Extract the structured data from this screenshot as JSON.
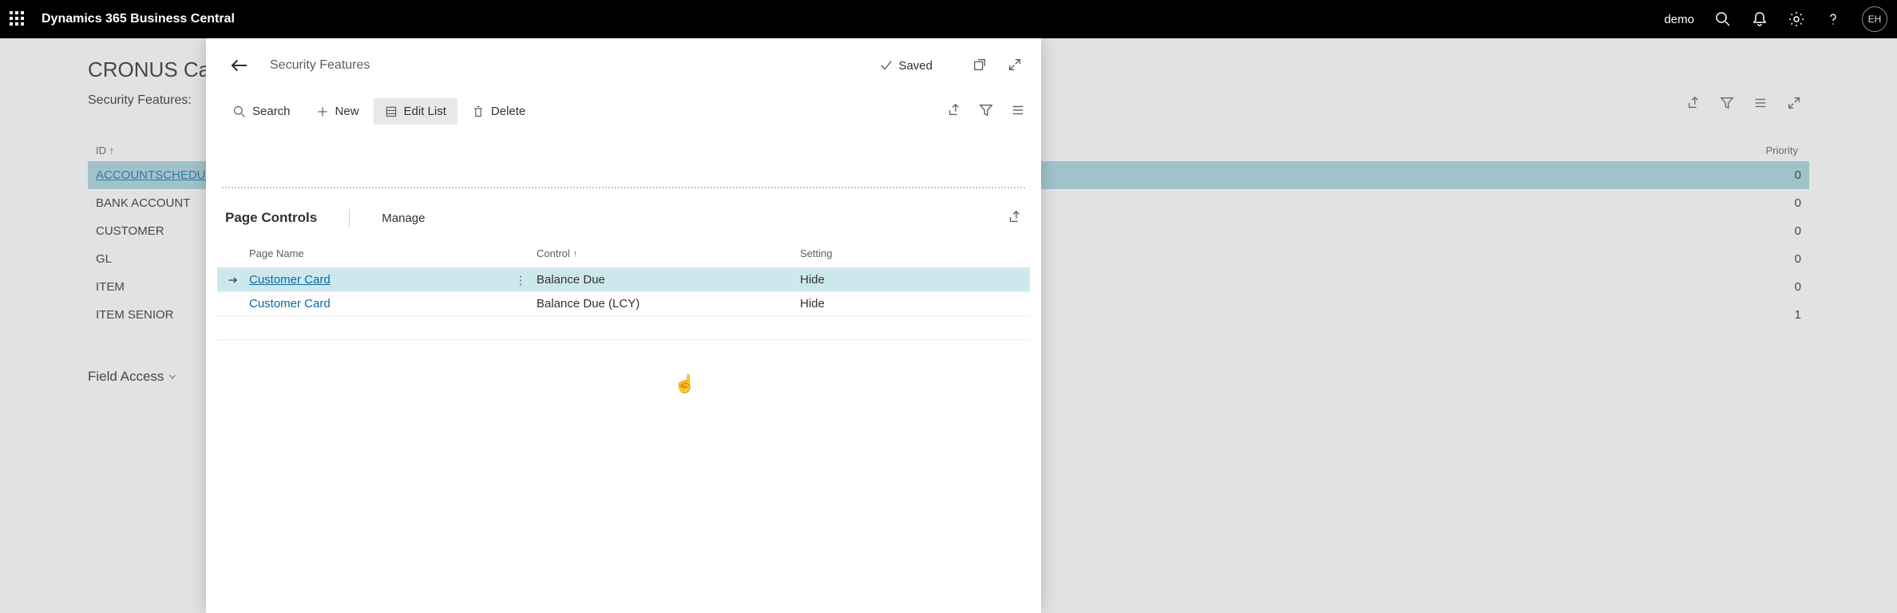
{
  "topbar": {
    "brand": "Dynamics 365 Business Central",
    "env": "demo",
    "avatar": "EH"
  },
  "background": {
    "company": "CRONUS Canad",
    "pageTitle": "Security Features:",
    "col_id": "ID",
    "col_priority": "Priority",
    "rows": [
      {
        "id": "ACCOUNTSCHEDULE",
        "priority": "0",
        "selected": true
      },
      {
        "id": "BANK ACCOUNT",
        "priority": "0"
      },
      {
        "id": "CUSTOMER",
        "priority": "0"
      },
      {
        "id": "GL",
        "priority": "0"
      },
      {
        "id": "ITEM",
        "priority": "0"
      },
      {
        "id": "ITEM SENIOR",
        "priority": "1"
      }
    ],
    "fieldAccess": "Field Access"
  },
  "panel": {
    "title": "Security Features",
    "savedLabel": "Saved",
    "toolbar": {
      "search": "Search",
      "new": "New",
      "editList": "Edit List",
      "delete": "Delete"
    },
    "section": {
      "title": "Page Controls",
      "manage": "Manage"
    },
    "grid": {
      "headers": {
        "pageName": "Page Name",
        "control": "Control",
        "setting": "Setting"
      },
      "rows": [
        {
          "pageName": "Customer Card",
          "control": "Balance Due",
          "setting": "Hide",
          "selected": true
        },
        {
          "pageName": "Customer Card",
          "control": "Balance Due (LCY)",
          "setting": "Hide"
        }
      ]
    }
  }
}
